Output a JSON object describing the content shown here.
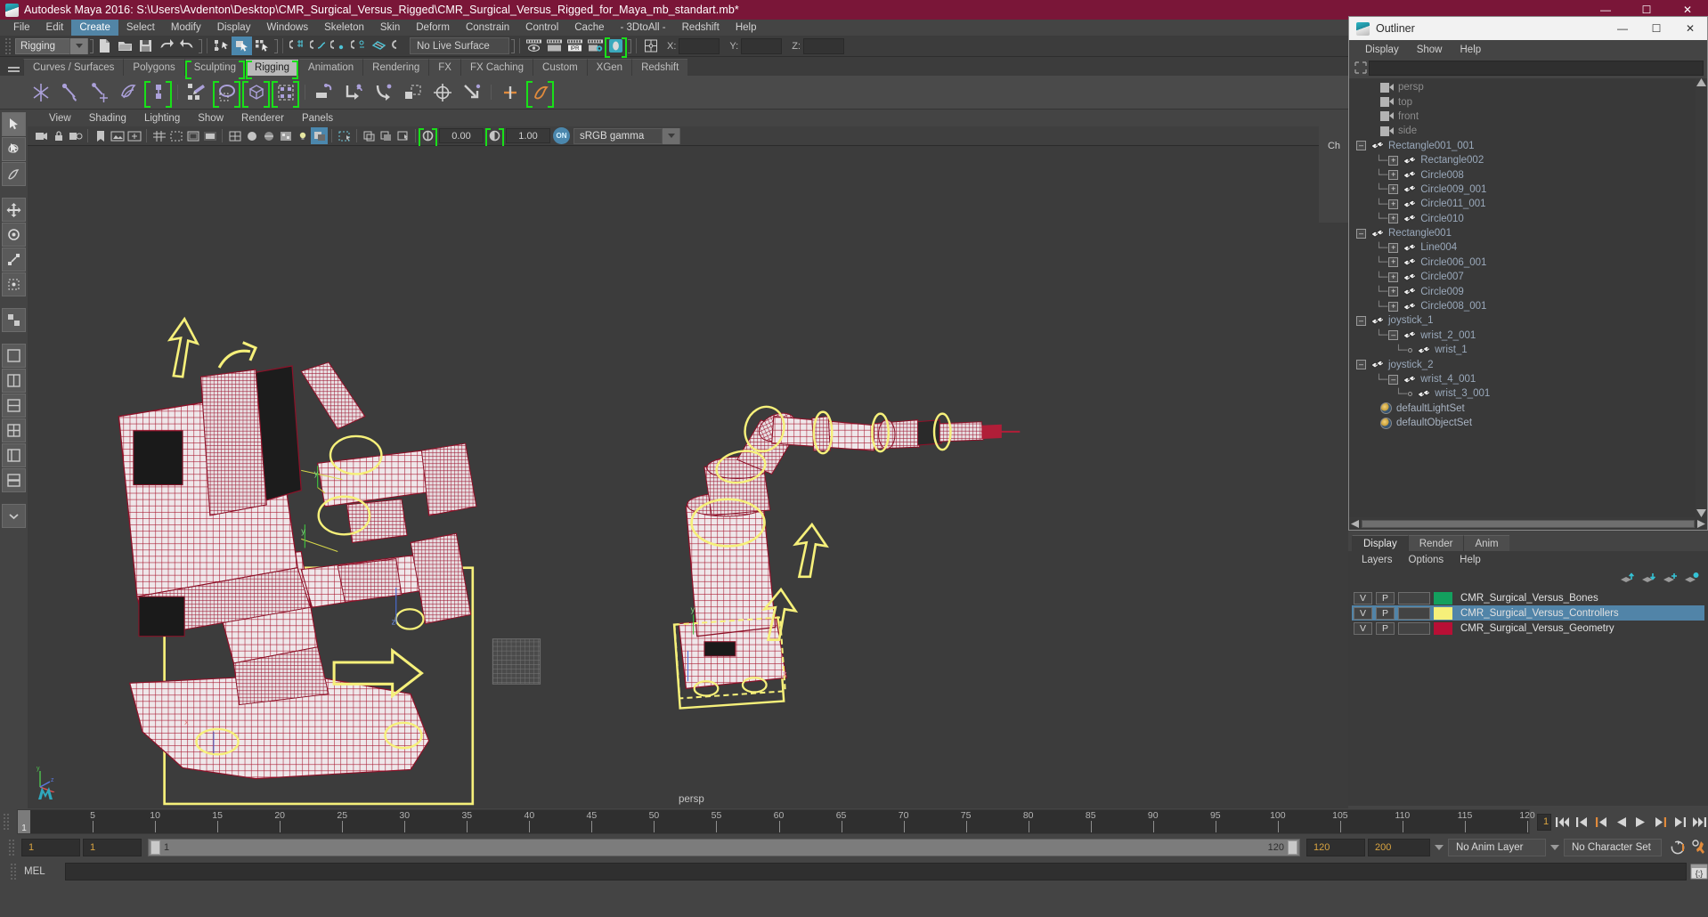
{
  "window": {
    "title": "Autodesk Maya 2016: S:\\Users\\Avdenton\\Desktop\\CMR_Surgical_Versus_Rigged\\CMR_Surgical_Versus_Rigged_for_Maya_mb_standart.mb*",
    "minimize": "—",
    "maximize": "☐",
    "close": "✕"
  },
  "menubar": {
    "items": [
      {
        "label": "File",
        "active": false
      },
      {
        "label": "Edit",
        "active": false
      },
      {
        "label": "Create",
        "active": true
      },
      {
        "label": "Select",
        "active": false
      },
      {
        "label": "Modify",
        "active": false
      },
      {
        "label": "Display",
        "active": false
      },
      {
        "label": "Windows",
        "active": false
      },
      {
        "label": "Skeleton",
        "active": false
      },
      {
        "label": "Skin",
        "active": false
      },
      {
        "label": "Deform",
        "active": false
      },
      {
        "label": "Constrain",
        "active": false
      },
      {
        "label": "Control",
        "active": false
      },
      {
        "label": "Cache",
        "active": false
      },
      {
        "label": "- 3DtoAll -",
        "active": false
      },
      {
        "label": "Redshift",
        "active": false
      },
      {
        "label": "Help",
        "active": false
      }
    ]
  },
  "statusline": {
    "menuset": "Rigging",
    "live_surface": "No Live Surface",
    "axis_x_label": "X:",
    "axis_y_label": "Y:",
    "axis_z_label": "Z:",
    "axis_x_value": "",
    "axis_y_value": "",
    "axis_z_value": "",
    "ipr_label": "IPR"
  },
  "shelf": {
    "tabs": [
      {
        "label": "Curves / Surfaces",
        "active": false,
        "bracket": false
      },
      {
        "label": "Polygons",
        "active": false,
        "bracket": false
      },
      {
        "label": "Sculpting",
        "active": false,
        "bracket": true
      },
      {
        "label": "Rigging",
        "active": true,
        "bracket": true
      },
      {
        "label": "Animation",
        "active": false,
        "bracket": false
      },
      {
        "label": "Rendering",
        "active": false,
        "bracket": false
      },
      {
        "label": "FX",
        "active": false,
        "bracket": false
      },
      {
        "label": "FX Caching",
        "active": false,
        "bracket": false
      },
      {
        "label": "Custom",
        "active": false,
        "bracket": false
      },
      {
        "label": "XGen",
        "active": false,
        "bracket": false
      },
      {
        "label": "Redshift",
        "active": false,
        "bracket": false
      }
    ]
  },
  "viewport": {
    "menus": [
      "View",
      "Shading",
      "Lighting",
      "Show",
      "Renderer",
      "Panels"
    ],
    "exposure_value": "0.00",
    "gamma_value": "1.00",
    "color_profile": "sRGB gamma",
    "on_label": "ON",
    "camera_label": "persp"
  },
  "outliner": {
    "title": "Outliner",
    "minimize": "—",
    "maximize": "☐",
    "close": "✕",
    "menus": [
      "Display",
      "Show",
      "Help"
    ],
    "search_value": "",
    "rows": [
      {
        "label": "persp",
        "indent": 1,
        "type": "camera",
        "expander": "none",
        "tree": ""
      },
      {
        "label": "top",
        "indent": 1,
        "type": "camera",
        "expander": "none",
        "tree": ""
      },
      {
        "label": "front",
        "indent": 1,
        "type": "camera",
        "expander": "none",
        "tree": ""
      },
      {
        "label": "side",
        "indent": 1,
        "type": "camera",
        "expander": "none",
        "tree": ""
      },
      {
        "label": "Rectangle001_001",
        "indent": 0,
        "type": "mesh",
        "expander": "minus",
        "tree": ""
      },
      {
        "label": "Rectangle002",
        "indent": 1,
        "type": "mesh",
        "expander": "plus",
        "tree": "branch"
      },
      {
        "label": "Circle008",
        "indent": 1,
        "type": "mesh",
        "expander": "plus",
        "tree": "branch"
      },
      {
        "label": "Circle009_001",
        "indent": 1,
        "type": "mesh",
        "expander": "plus",
        "tree": "branch"
      },
      {
        "label": "Circle011_001",
        "indent": 1,
        "type": "mesh",
        "expander": "plus",
        "tree": "branch"
      },
      {
        "label": "Circle010",
        "indent": 1,
        "type": "mesh",
        "expander": "plus",
        "tree": "last"
      },
      {
        "label": "Rectangle001",
        "indent": 0,
        "type": "mesh",
        "expander": "minus",
        "tree": ""
      },
      {
        "label": "Line004",
        "indent": 1,
        "type": "mesh",
        "expander": "plus",
        "tree": "branch"
      },
      {
        "label": "Circle006_001",
        "indent": 1,
        "type": "mesh",
        "expander": "plus",
        "tree": "branch"
      },
      {
        "label": "Circle007",
        "indent": 1,
        "type": "mesh",
        "expander": "plus",
        "tree": "branch"
      },
      {
        "label": "Circle009",
        "indent": 1,
        "type": "mesh",
        "expander": "plus",
        "tree": "branch"
      },
      {
        "label": "Circle008_001",
        "indent": 1,
        "type": "mesh",
        "expander": "plus",
        "tree": "last"
      },
      {
        "label": "joystick_1",
        "indent": 0,
        "type": "mesh",
        "expander": "minus",
        "tree": ""
      },
      {
        "label": "wrist_2_001",
        "indent": 1,
        "type": "mesh",
        "expander": "minus",
        "tree": "last"
      },
      {
        "label": "wrist_1",
        "indent": 2,
        "type": "mesh",
        "expander": "dot",
        "tree": "last"
      },
      {
        "label": "joystick_2",
        "indent": 0,
        "type": "mesh",
        "expander": "minus",
        "tree": ""
      },
      {
        "label": "wrist_4_001",
        "indent": 1,
        "type": "mesh",
        "expander": "minus",
        "tree": "last"
      },
      {
        "label": "wrist_3_001",
        "indent": 2,
        "type": "mesh",
        "expander": "dot",
        "tree": "last"
      },
      {
        "label": "defaultLightSet",
        "indent": 1,
        "type": "set",
        "expander": "none",
        "tree": ""
      },
      {
        "label": "defaultObjectSet",
        "indent": 1,
        "type": "set",
        "expander": "none",
        "tree": ""
      }
    ]
  },
  "channelbox": {
    "tab_label": "Ch"
  },
  "layer_editor": {
    "tabs": [
      {
        "label": "Display",
        "active": true
      },
      {
        "label": "Render",
        "active": false
      },
      {
        "label": "Anim",
        "active": false
      }
    ],
    "menus": [
      "Layers",
      "Options",
      "Help"
    ],
    "layers": [
      {
        "v": "V",
        "p": "P",
        "color": "#13a05e",
        "name": "CMR_Surgical_Versus_Bones",
        "selected": false
      },
      {
        "v": "V",
        "p": "P",
        "color": "#f6f07a",
        "name": "CMR_Surgical_Versus_Controllers",
        "selected": true
      },
      {
        "v": "V",
        "p": "P",
        "color": "#b80f35",
        "name": "CMR_Surgical_Versus_Geometry",
        "selected": false
      }
    ]
  },
  "timeline": {
    "current_frame": "1",
    "ticks": [
      5,
      10,
      15,
      20,
      25,
      30,
      35,
      40,
      45,
      50,
      55,
      60,
      65,
      70,
      75,
      80,
      85,
      90,
      95,
      100,
      105,
      110,
      115,
      120
    ],
    "frame_field": "1",
    "playback_buttons": [
      "go-to-start",
      "step-back-key",
      "step-back-frame",
      "play-backwards",
      "play-forwards",
      "step-forward-frame",
      "step-forward-key",
      "go-to-end"
    ]
  },
  "range": {
    "start": "1",
    "playback_start": "1",
    "track_start_label": "1",
    "track_end_label": "120",
    "playback_end": "120",
    "end": "200",
    "anim_layer": "No Anim Layer",
    "character_set": "No Character Set"
  },
  "command_line": {
    "mel_label": "MEL",
    "input_value": ""
  },
  "colors": {
    "title_bar": "#7a1638",
    "accent_select": "#4b87ad",
    "shelf_highlight": "#19e019",
    "controller_yellow": "#f6f07a",
    "geometry_red": "#b80f35",
    "bones_green": "#13a05e",
    "timeline_orange": "#d9a441"
  }
}
